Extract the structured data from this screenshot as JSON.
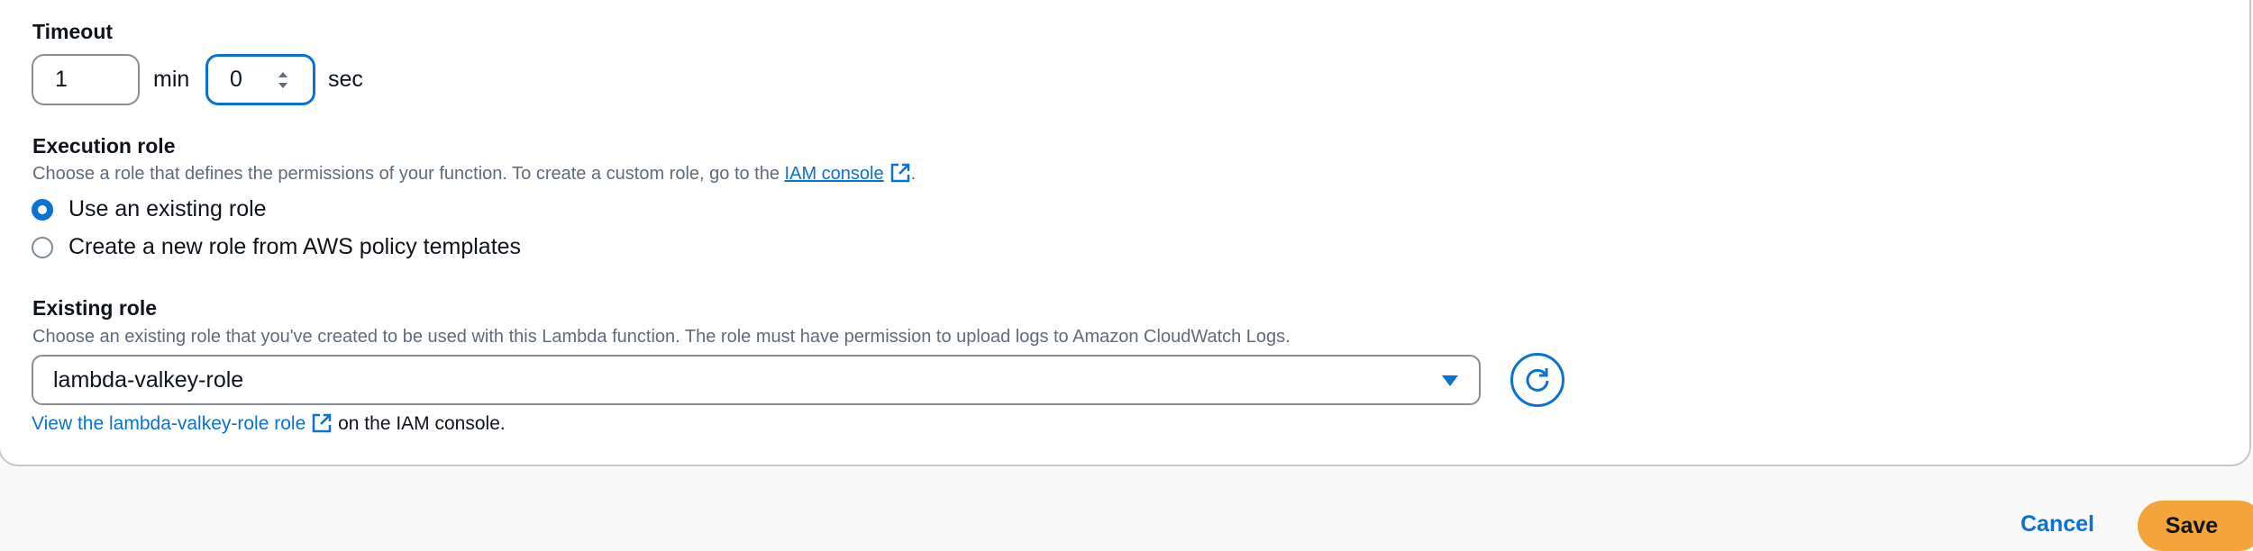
{
  "timeout": {
    "label": "Timeout",
    "minutes_value": "1",
    "minutes_unit": "min",
    "seconds_value": "0",
    "seconds_unit": "sec"
  },
  "execution_role": {
    "label": "Execution role",
    "description_prefix": "Choose a role that defines the permissions of your function. To create a custom role, go to the ",
    "iam_console_link": "IAM console",
    "description_suffix": ".",
    "options": [
      {
        "label": "Use an existing role",
        "checked": true
      },
      {
        "label": "Create a new role from AWS policy templates",
        "checked": false
      }
    ]
  },
  "existing_role": {
    "label": "Existing role",
    "description": "Choose an existing role that you've created to be used with this Lambda function. The role must have permission to upload logs to Amazon CloudWatch Logs.",
    "selected_value": "lambda-valkey-role",
    "view_link": "View the lambda-valkey-role role",
    "view_suffix": "on the IAM console."
  },
  "footer": {
    "cancel_label": "Cancel",
    "save_label": "Save"
  },
  "colors": {
    "link": "#0972d3",
    "primary_button": "#f3a43b",
    "border": "#8c8c94"
  },
  "icons": {
    "external_link": "external-link-icon",
    "refresh": "refresh-icon",
    "dropdown": "caret-down-icon",
    "stepper": "number-stepper-icon"
  }
}
